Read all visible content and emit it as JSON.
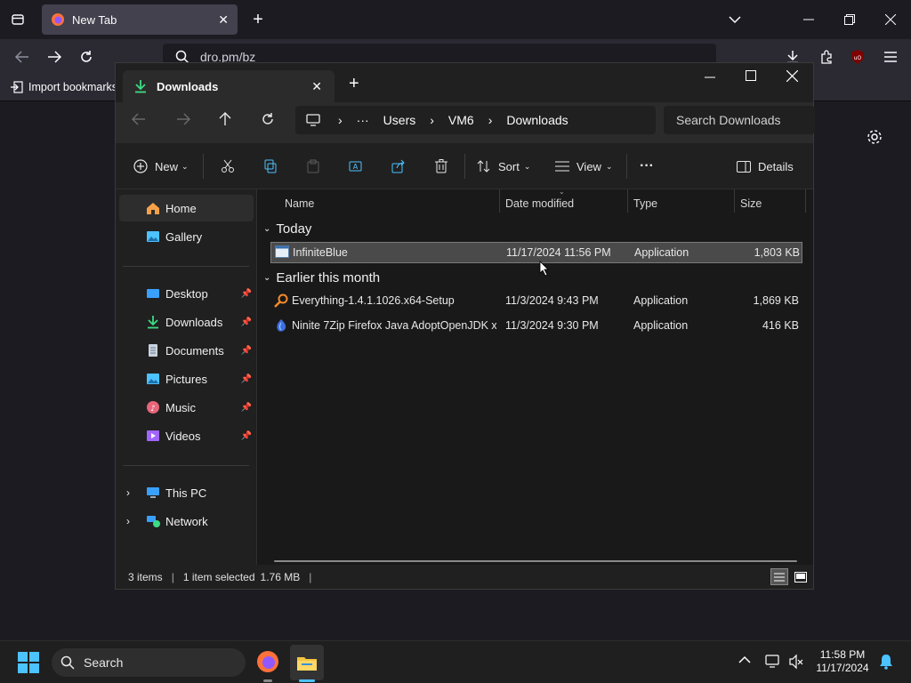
{
  "firefox": {
    "tab_title": "New Tab",
    "url": "dro.pm/bz",
    "bookmark_import": "Import bookmarks..."
  },
  "explorer": {
    "tab_title": "Downloads",
    "address": {
      "ellipsis": "···",
      "segments": [
        "Users",
        "VM6",
        "Downloads"
      ]
    },
    "search_placeholder": "Search Downloads",
    "toolbar": {
      "new_label": "New",
      "sort_label": "Sort",
      "view_label": "View",
      "more_label": "···",
      "details_label": "Details"
    },
    "nav": {
      "home": "Home",
      "gallery": "Gallery",
      "desktop": "Desktop",
      "downloads": "Downloads",
      "documents": "Documents",
      "pictures": "Pictures",
      "music": "Music",
      "videos": "Videos",
      "this_pc": "This PC",
      "network": "Network"
    },
    "columns": {
      "name": "Name",
      "date": "Date modified",
      "type": "Type",
      "size": "Size"
    },
    "groups": [
      {
        "label": "Today",
        "files": [
          {
            "name": "InfiniteBlue",
            "date": "11/17/2024 11:56 PM",
            "type": "Application",
            "size": "1,803 KB",
            "icon": "app-window-icon",
            "selected": true
          }
        ]
      },
      {
        "label": "Earlier this month",
        "files": [
          {
            "name": "Everything-1.4.1.1026.x64-Setup",
            "date": "11/3/2024 9:43 PM",
            "type": "Application",
            "size": "1,869 KB",
            "icon": "magnifier-app-icon",
            "selected": false
          },
          {
            "name": "Ninite 7Zip Firefox Java AdoptOpenJDK x...",
            "date": "11/3/2024 9:30 PM",
            "type": "Application",
            "size": "416 KB",
            "icon": "ninite-icon",
            "selected": false
          }
        ]
      }
    ],
    "status": {
      "items": "3 items",
      "selected": "1 item selected",
      "size": "1.76 MB"
    }
  },
  "taskbar": {
    "search_label": "Search",
    "time": "11:58 PM",
    "date": "11/17/2024"
  },
  "colors": {
    "accent": "#4cc2ff",
    "selection": "#4a4a4a",
    "folder_yellow": "#f5c542",
    "downloads_green": "#3ddc84"
  }
}
